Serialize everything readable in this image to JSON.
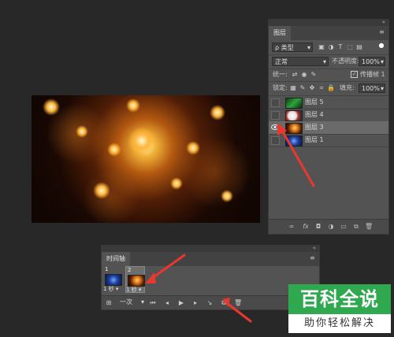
{
  "layers_panel": {
    "tab_label": "图层",
    "filter_label": "ρ 类型",
    "blend_mode": "正常",
    "opacity_label": "不透明度:",
    "opacity_value": "100%",
    "unify_label": "统一:",
    "propagate_label": "传播帧 1",
    "lock_label": "锁定:",
    "fill_label": "填充:",
    "fill_value": "100%",
    "layers": [
      {
        "name": "图层 5",
        "visible": false,
        "selected": false
      },
      {
        "name": "图层 4",
        "visible": false,
        "selected": false
      },
      {
        "name": "图层 3",
        "visible": true,
        "selected": true
      },
      {
        "name": "图层 1",
        "visible": false,
        "selected": false
      }
    ]
  },
  "timeline": {
    "tab_label": "时间轴",
    "frames": [
      {
        "number": "1",
        "delay": "1 秒 ▾"
      },
      {
        "number": "2",
        "delay": "1 秒 ▾"
      }
    ],
    "loop_label": "一次",
    "icons": [
      "convert-icon",
      "first-frame-icon",
      "prev-frame-icon",
      "play-icon",
      "next-frame-icon",
      "tween-icon",
      "new-frame-icon",
      "delete-frame-icon"
    ]
  },
  "watermark": {
    "top": "百科全说",
    "bottom": "助你轻松解决"
  },
  "colors": {
    "background": "#282828",
    "panel": "#535353",
    "arrow": "#e8382f",
    "brand_green": "#2fa84f"
  }
}
